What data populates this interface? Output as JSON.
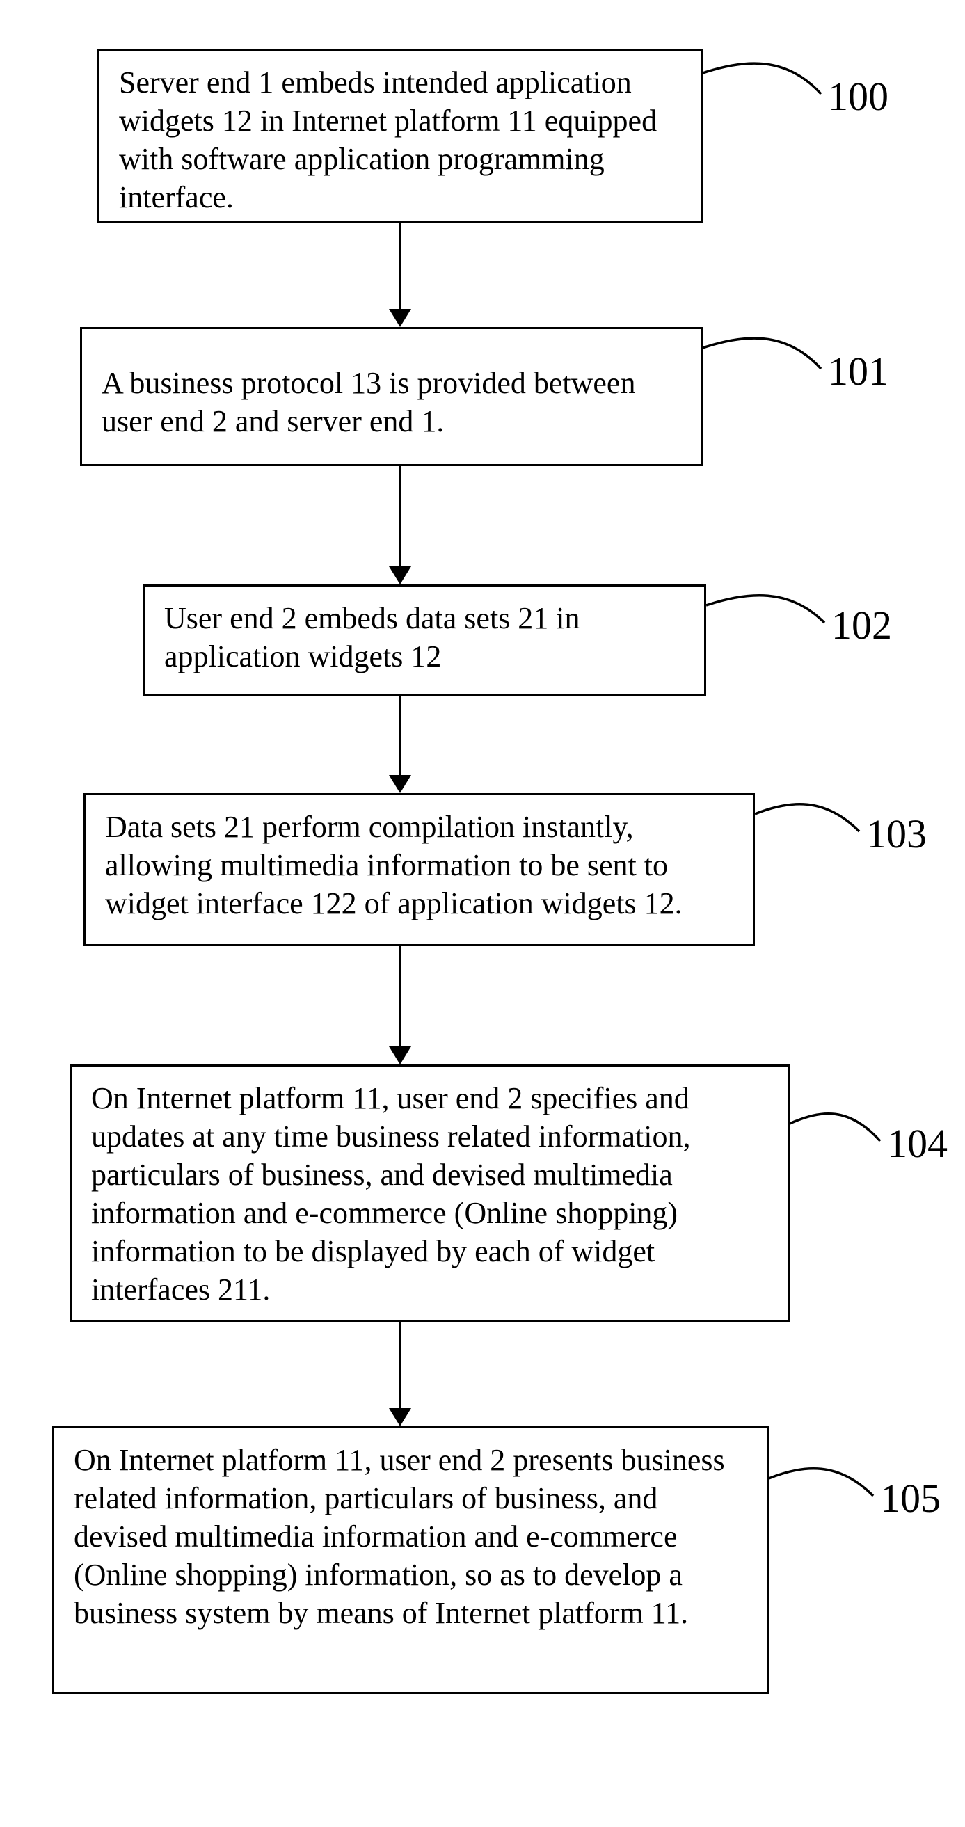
{
  "steps": [
    {
      "id": "100",
      "text": "Server end 1 embeds intended application widgets 12 in Internet platform 11 equipped with software application programming interface."
    },
    {
      "id": "101",
      "text": "A business protocol 13 is provided between user end 2 and server end 1."
    },
    {
      "id": "102",
      "text": "User end 2 embeds data sets 21 in application widgets 12"
    },
    {
      "id": "103",
      "text": "Data sets 21 perform compilation instantly, allowing multimedia information to be sent to widget interface 122 of application widgets 12."
    },
    {
      "id": "104",
      "text": "On Internet platform 11, user end 2 specifies and updates at any time business related information, particulars of business, and devised multimedia information and e-commerce (Online shopping) information to be displayed by each of widget interfaces 211."
    },
    {
      "id": "105",
      "text": "On Internet platform 11, user end 2 presents business related information, particulars of business, and devised multimedia information and e-commerce (Online shopping) information, so as to develop a business system by means of Internet platform 11."
    }
  ]
}
